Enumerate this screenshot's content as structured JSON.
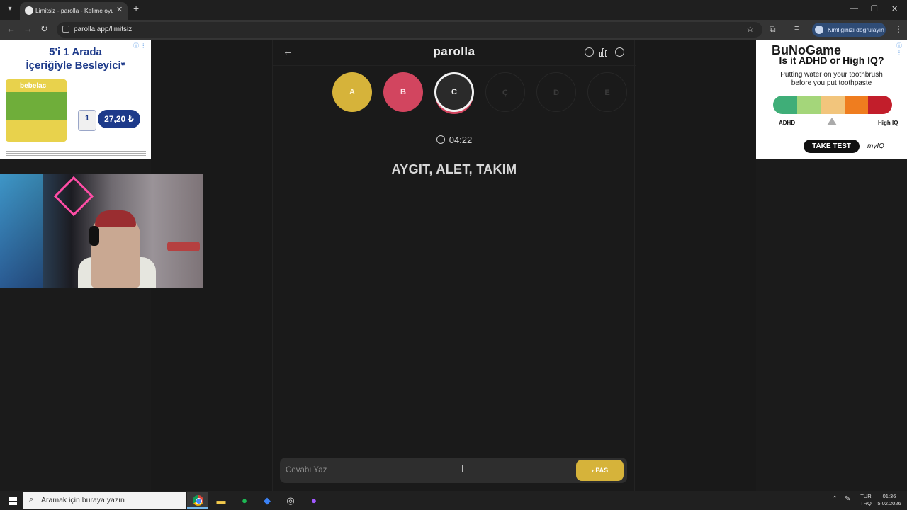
{
  "browser": {
    "tab_title": "Limitsiz - parolla - Kelime oyunu",
    "url": "parolla.app/limitsiz",
    "identity_label": "Kimliğinizi doğrulayın"
  },
  "game": {
    "logo": "parolla",
    "letters": [
      {
        "letter": "A",
        "state": "correct"
      },
      {
        "letter": "B",
        "state": "wrong"
      },
      {
        "letter": "C",
        "state": "current"
      },
      {
        "letter": "Ç",
        "state": "pending"
      },
      {
        "letter": "D",
        "state": "pending"
      },
      {
        "letter": "E",
        "state": "pending"
      }
    ],
    "timer": "04:22",
    "clue": "AYGIT, ALET, TAKIM",
    "answer_placeholder": "Cevabı Yaz",
    "pass_label": "PAS",
    "colors": {
      "correct": "#d6b33a",
      "wrong": "#d2455f",
      "current": "#f2f2f2"
    }
  },
  "ads": {
    "left": {
      "headline1": "5'i 1 Arada",
      "headline2": "İçeriğiyle Besleyici*",
      "brand": "bebelac",
      "cup_label": "1",
      "price": "27,20 ₺"
    },
    "right": {
      "overlay": "BuNoGame",
      "title": "Is it ADHD or High IQ?",
      "text1": "Putting water on your toothbrush",
      "text2": "before you put toothpaste",
      "scale_low": "ADHD",
      "scale_high": "High IQ",
      "button": "TAKE TEST",
      "logo": "myIQ",
      "scale_colors": [
        "#3fae78",
        "#a4d67a",
        "#f2c57c",
        "#ef7d1f",
        "#c21e2b"
      ]
    }
  },
  "taskbar": {
    "search_placeholder": "Aramak için buraya yazın",
    "lang_top": "TUR",
    "lang_bottom": "TRQ",
    "time": "01:36",
    "date": "5.02.2026"
  }
}
